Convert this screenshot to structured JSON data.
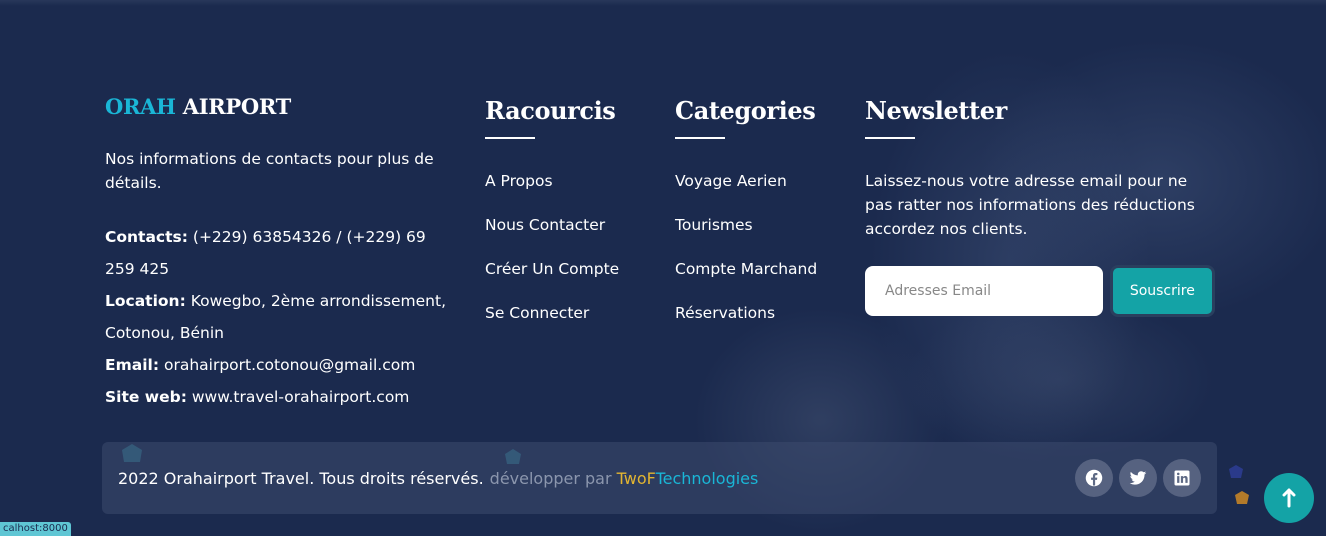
{
  "brand": {
    "title_accent": "ORAH",
    "title_rest": "AIRPORT",
    "description": "Nos informations de contacts pour plus de détails.",
    "contacts_label": "Contacts:",
    "contacts_value": "(+229) 63854326 / (+229) 69 259 425",
    "location_label": "Location:",
    "location_value": "Kowegbo, 2ème arrondissement, Cotonou, Bénin",
    "email_label": "Email:",
    "email_value": "orahairport.cotonou@gmail.com",
    "site_label": "Site web:",
    "site_value": "www.travel-orahairport.com"
  },
  "shortcuts": {
    "heading": "Racourcis",
    "links": [
      "A Propos",
      "Nous Contacter",
      "Créer Un Compte",
      "Se Connecter"
    ]
  },
  "categories": {
    "heading": "Categories",
    "links": [
      "Voyage Aerien",
      "Tourismes",
      "Compte Marchand",
      "Réservations"
    ]
  },
  "newsletter": {
    "heading": "Newsletter",
    "text": "Laissez-nous votre adresse email pour ne pas ratter nos informations des réductions accordez nos clients.",
    "placeholder": "Adresses Email",
    "button": "Souscrire"
  },
  "footer": {
    "copyright": "2022 Orahairport Travel. Tous droits réservés.",
    "developed_by": "développer par",
    "dev_brand_a": "TwoF",
    "dev_brand_b": "Technologies"
  },
  "socials": [
    "facebook-icon",
    "twitter-icon",
    "linkedin-icon"
  ],
  "status_url": "calhost:8000",
  "colors": {
    "background": "#1b2a4e",
    "accent": "#1ab6d6",
    "button": "#14a3a6",
    "brand_gold": "#e2b531"
  }
}
